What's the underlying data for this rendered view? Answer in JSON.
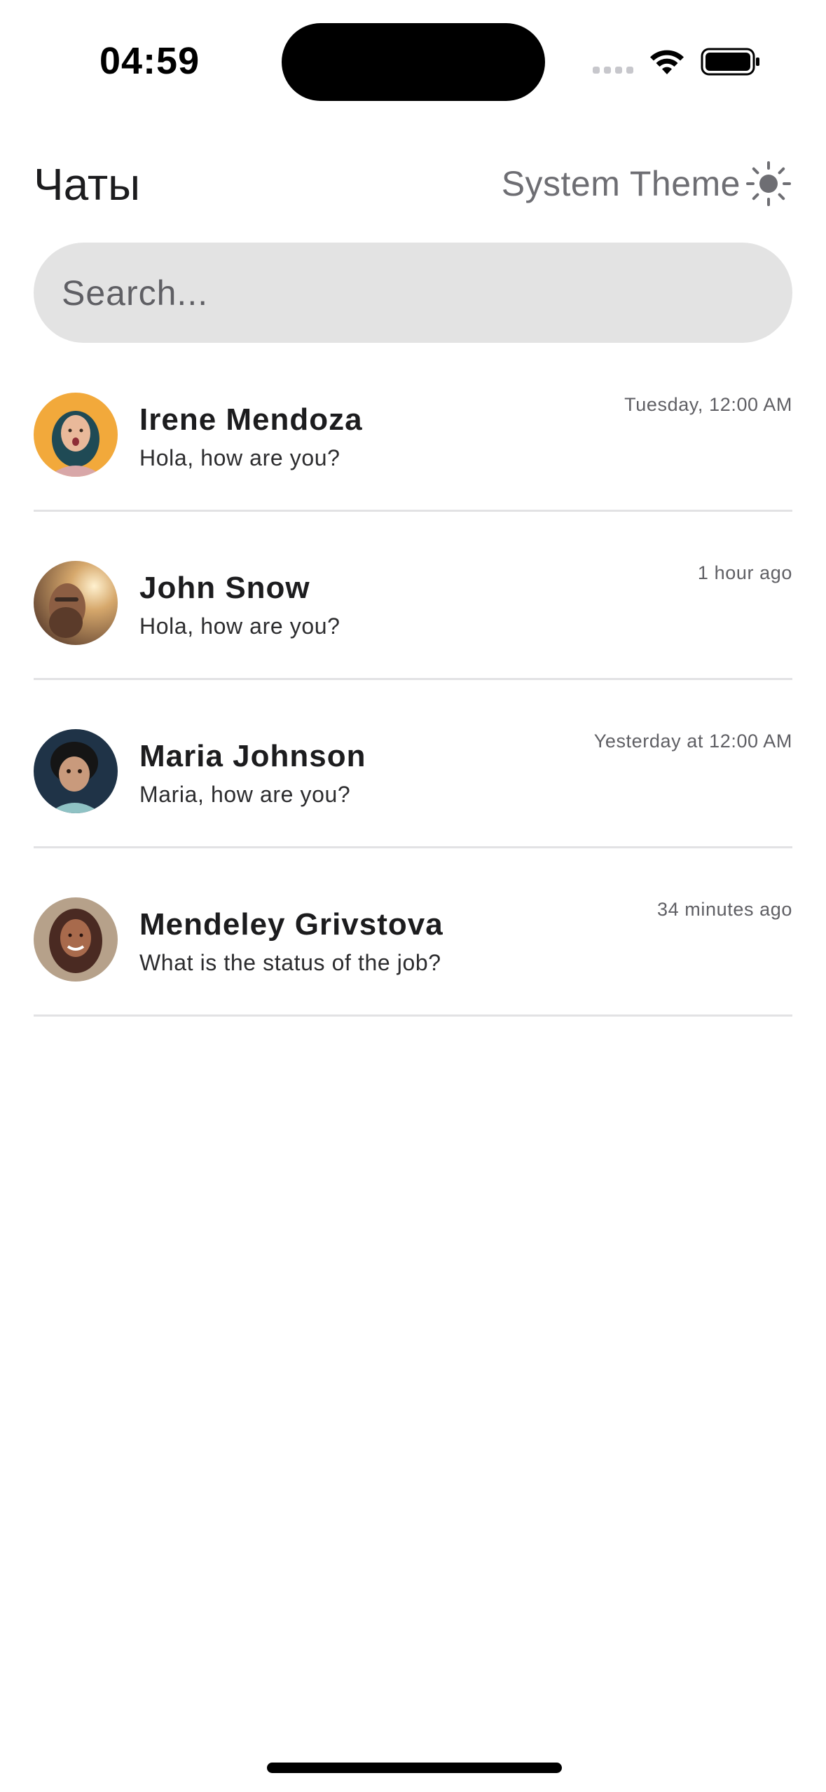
{
  "status_bar": {
    "time": "04:59"
  },
  "header": {
    "title": "Чаты",
    "theme_label": "System Theme",
    "theme_icon": "sun-icon"
  },
  "search": {
    "placeholder": "Search...",
    "value": ""
  },
  "chats": [
    {
      "name": "Irene Mendoza",
      "message": "Hola, how are you?",
      "time": "Tuesday, 12:00 AM",
      "avatar": "avatar-irene"
    },
    {
      "name": "John Snow",
      "message": "Hola, how are you?",
      "time": "1 hour ago",
      "avatar": "avatar-john"
    },
    {
      "name": "Maria Johnson",
      "message": "Maria, how are you?",
      "time": "Yesterday at 12:00 AM",
      "avatar": "avatar-maria"
    },
    {
      "name": "Mendeley Grivstova",
      "message": "What is the status of the job?",
      "time": "34 minutes ago",
      "avatar": "avatar-mendeley"
    }
  ],
  "colors": {
    "search_background": "#e3e3e3",
    "divider": "#e2e2e4",
    "secondary_text": "#6e6e73"
  }
}
